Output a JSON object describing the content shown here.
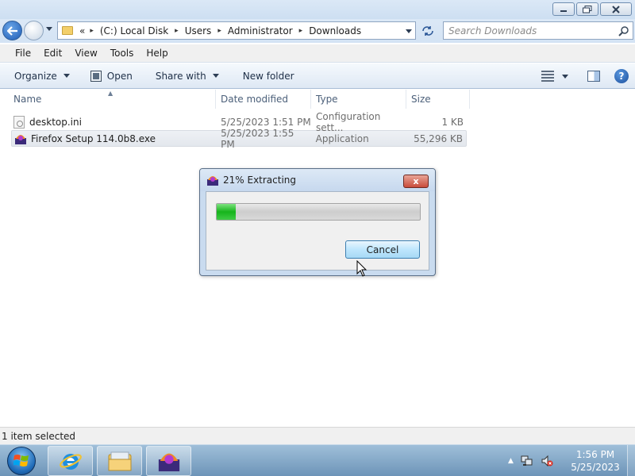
{
  "window": {
    "minimize_icon": "minimize-icon",
    "maximize_icon": "restore-icon",
    "close_icon": "close-icon"
  },
  "address": {
    "overflow": "«",
    "crumbs": [
      "(C:) Local Disk",
      "Users",
      "Administrator",
      "Downloads"
    ],
    "separator": "▸"
  },
  "search": {
    "placeholder": "Search Downloads"
  },
  "menu": [
    "File",
    "Edit",
    "View",
    "Tools",
    "Help"
  ],
  "toolbar": {
    "organize": "Organize",
    "open": "Open",
    "share_with": "Share with",
    "new_folder": "New folder"
  },
  "columns": {
    "name": "Name",
    "date": "Date modified",
    "type": "Type",
    "size": "Size"
  },
  "files": [
    {
      "name": "desktop.ini",
      "date": "5/25/2023 1:51 PM",
      "type": "Configuration sett...",
      "size": "1 KB",
      "icon": "ini-file-icon",
      "selected": false
    },
    {
      "name": "Firefox Setup 114.0b8.exe",
      "date": "5/25/2023 1:55 PM",
      "type": "Application",
      "size": "55,296 KB",
      "icon": "installer-icon",
      "selected": true
    }
  ],
  "dialog": {
    "title": "21% Extracting",
    "progress": 0.095,
    "cancel": "Cancel",
    "close_label": "x"
  },
  "status": {
    "text": "1 item selected"
  },
  "clock": {
    "time": "1:56 PM",
    "date": "5/25/2023"
  },
  "colors": {
    "accent": "#1d5bb5",
    "progress": "#16b41c",
    "selection": "#e3e7ed"
  }
}
